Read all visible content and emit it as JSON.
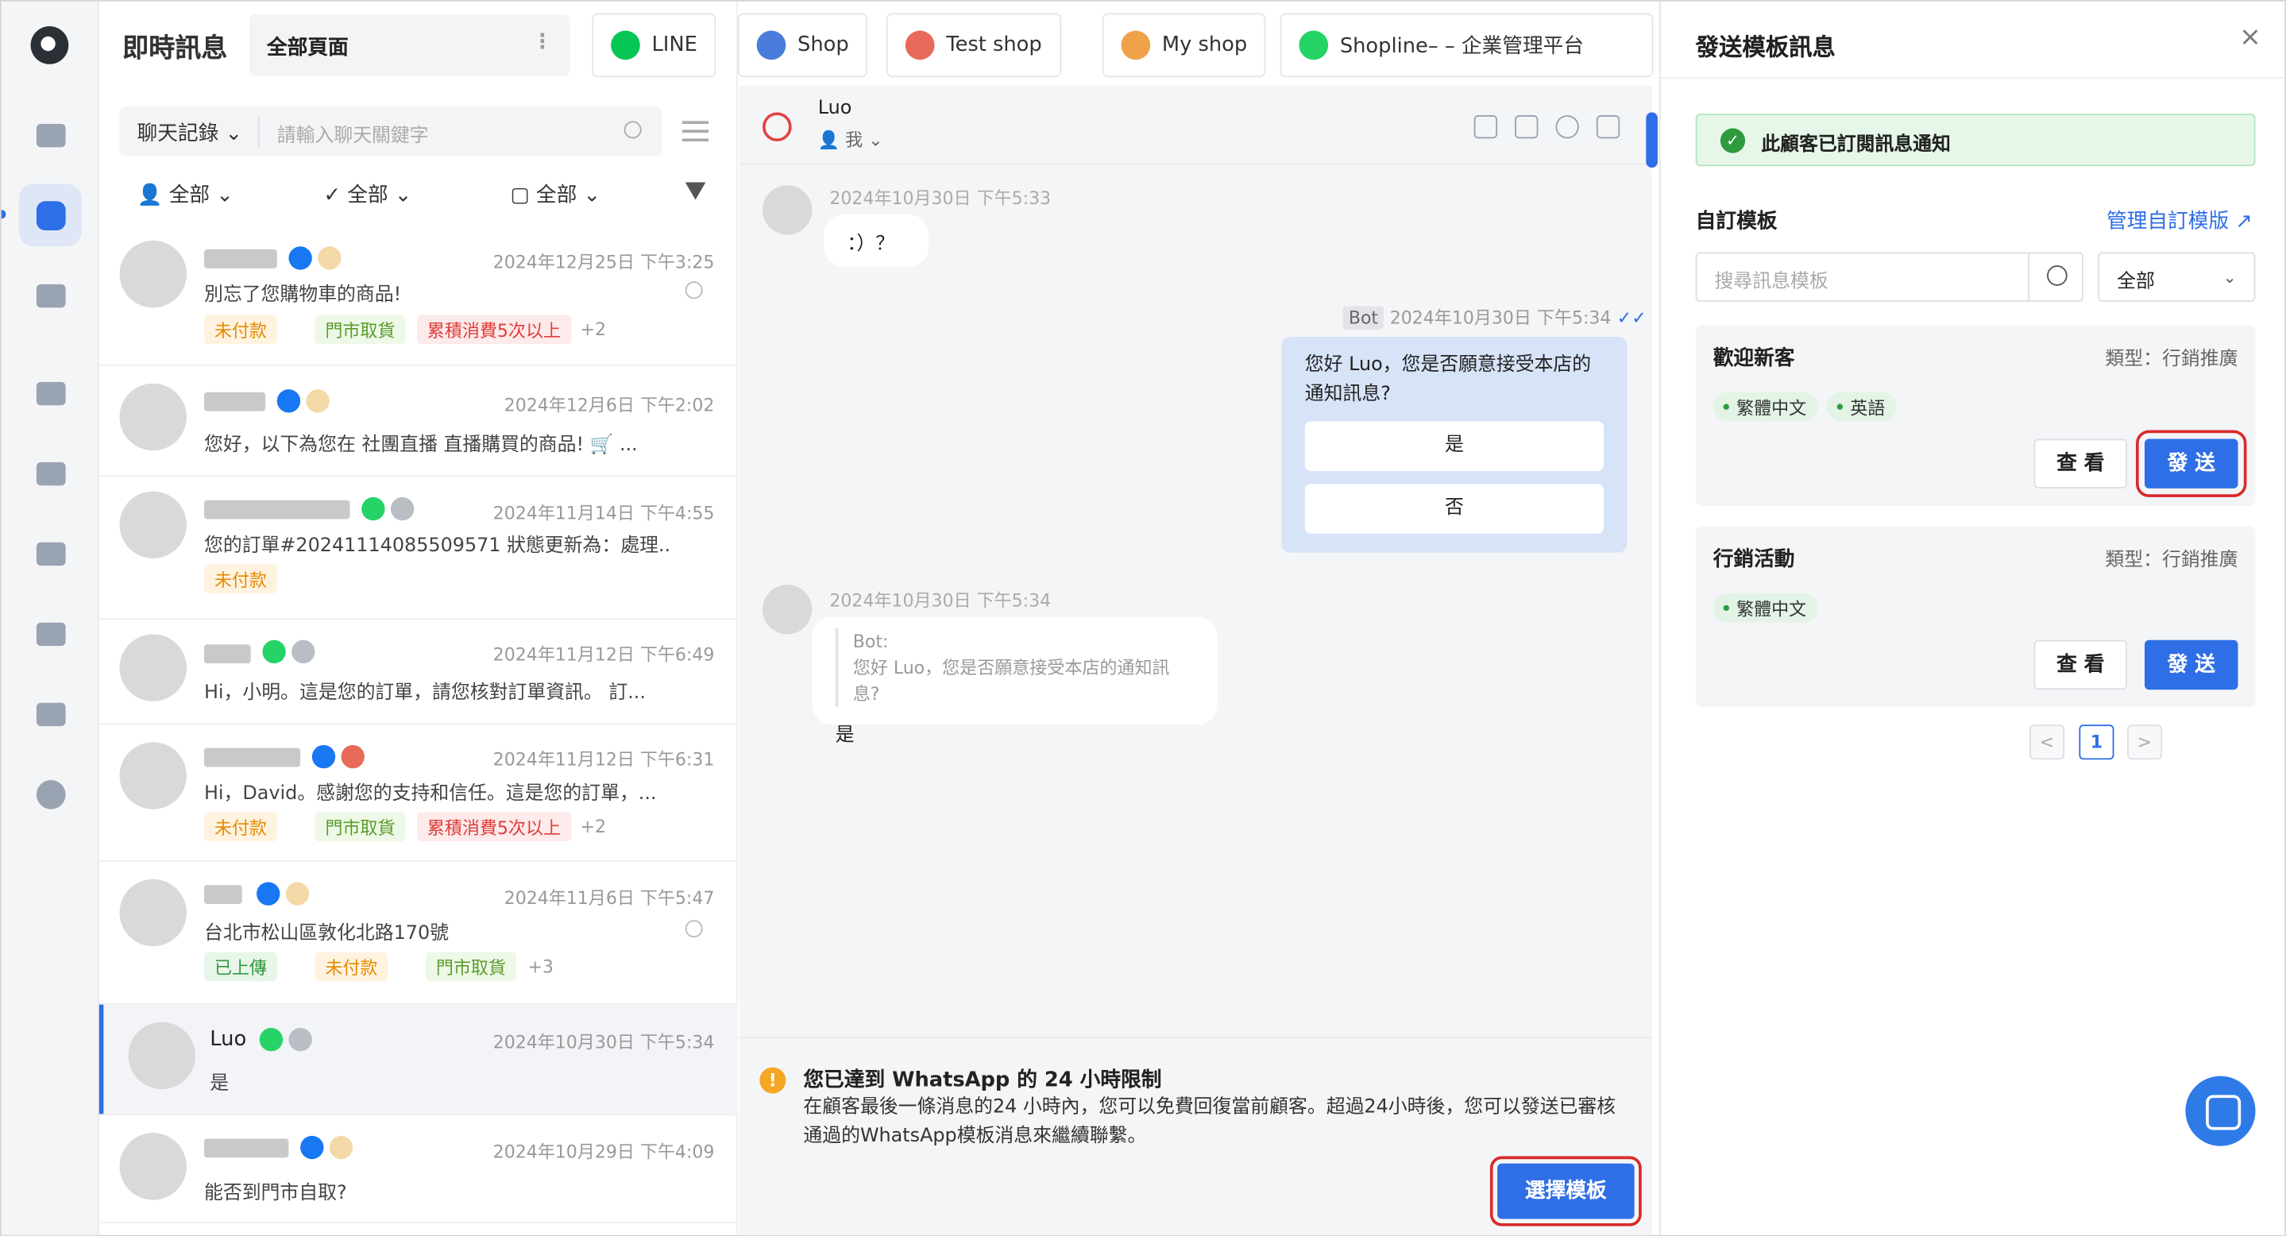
{
  "app": {
    "title": "即時訊息",
    "page_select": "全部頁面"
  },
  "tabs": [
    {
      "label": "LINE",
      "color": "#06c755"
    },
    {
      "label": "Shop",
      "color": "#4a7cdb"
    },
    {
      "label": "Test shop",
      "color": "#e86a5a"
    },
    {
      "label": "My shop",
      "color": "#f0a24a"
    },
    {
      "label": "Shopline–        – 企業管理平台",
      "color": "#25d366"
    }
  ],
  "list": {
    "search_scope": "聊天記錄 ⌄",
    "search_placeholder": "請輸入聊天關鍵字",
    "filters": [
      "全部 ⌄",
      "全部 ⌄",
      "全部 ⌄"
    ],
    "conversations": [
      {
        "time": "2024年12月25日 下午3:25",
        "preview": "別忘了您購物車的商品!",
        "tags": [
          "未付款",
          "門市取貨",
          "累積消費5次以上"
        ],
        "more": "+2"
      },
      {
        "time": "2024年12月6日 下午2:02",
        "preview": "您好，以下為您在 社團直播 直播購買的商品!  🛒 ...",
        "tags": [],
        "more": ""
      },
      {
        "time": "2024年11月14日 下午4:55",
        "preview": "您的訂單#20241114085509571 狀態更新為：處理...",
        "tags": [
          "未付款"
        ],
        "more": ""
      },
      {
        "time": "2024年11月12日 下午6:49",
        "preview": "Hi，小明。這是您的訂單，請您核對訂單資訊。 訂...",
        "tags": [],
        "more": ""
      },
      {
        "time": "2024年11月12日 下午6:31",
        "preview": "Hi，David。感謝您的支持和信任。這是您的訂單，...",
        "tags": [
          "未付款",
          "門市取貨",
          "累積消費5次以上"
        ],
        "more": "+2"
      },
      {
        "time": "2024年11月6日 下午5:47",
        "preview": "台北市松山區敦化北路170號",
        "tags": [
          "已上傳",
          "未付款",
          "門市取貨"
        ],
        "more": "+3"
      },
      {
        "name": "Luo",
        "time": "2024年10月30日 下午5:34",
        "preview": "是",
        "tags": [],
        "more": ""
      },
      {
        "time": "2024年10月29日 下午4:09",
        "preview": "能否到門市自取?",
        "tags": [],
        "more": ""
      }
    ]
  },
  "chat": {
    "name": "Luo",
    "assignee": "我 ⌄",
    "msg1": {
      "time": "2024年10月30日 下午5:33",
      "text": "：）？"
    },
    "bot": {
      "label": "Bot",
      "time": "2024年10月30日 下午5:34",
      "ticks": "✓✓",
      "text": "您好 Luo，您是否願意接受本店的通知訊息?",
      "yes": "是",
      "no": "否"
    },
    "msg2": {
      "time": "2024年10月30日 下午5:34",
      "quote_label": "Bot:",
      "quote_text": "您好 Luo，您是否願意接受本店的通知訊息?",
      "answer": "是"
    },
    "limit": {
      "icon": "!",
      "title": "您已達到 WhatsApp 的 24 小時限制",
      "body": "在顧客最後一條消息的24 小時內，您可以免費回復當前顧客。超過24小時後，您可以發送已審核通過的WhatsApp模板消息來繼續聯繫。",
      "button": "選擇模板"
    }
  },
  "panel": {
    "title": "發送模板訊息",
    "close": "×",
    "subscribed": "此顧客已訂閱訊息通知",
    "section": "自訂模板",
    "manage": "管理自訂模版 ↗",
    "search_placeholder": "搜尋訊息模板",
    "select": "全部",
    "select_chev": "⌄",
    "templates": [
      {
        "name": "歡迎新客",
        "type": "類型：行銷推廣",
        "langs": [
          "繁體中文",
          "英語"
        ],
        "view": "查 看",
        "send": "發 送"
      },
      {
        "name": "行銷活動",
        "type": "類型：行銷推廣",
        "langs": [
          "繁體中文"
        ],
        "view": "查 看",
        "send": "發 送"
      }
    ],
    "pager": {
      "prev": "<",
      "page": "1",
      "next": ">"
    }
  }
}
